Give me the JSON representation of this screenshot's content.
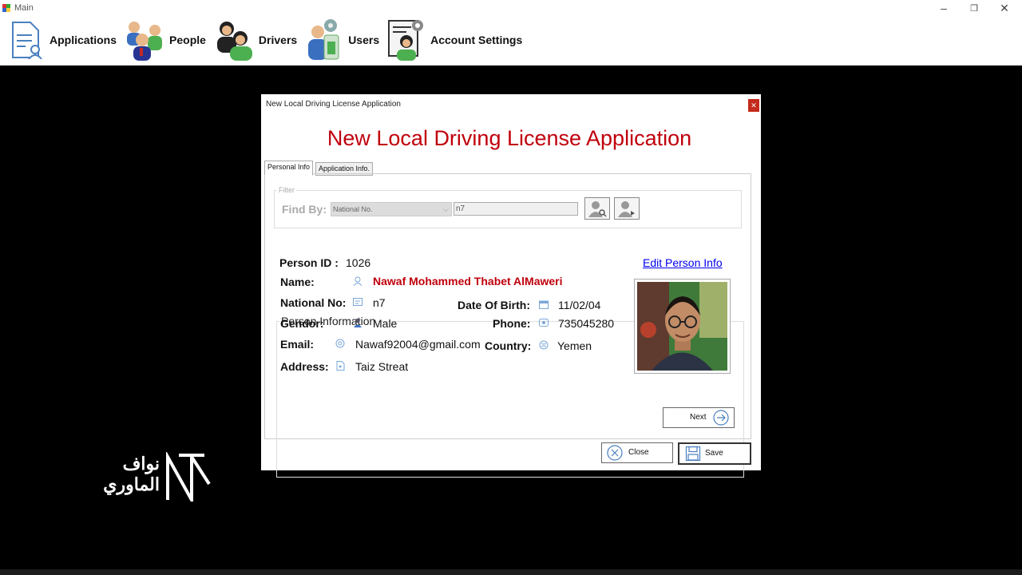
{
  "window": {
    "title": "Main"
  },
  "menu": [
    {
      "label": "Applications",
      "icon": "applications-icon"
    },
    {
      "label": "People",
      "icon": "people-icon"
    },
    {
      "label": "Drivers",
      "icon": "drivers-icon"
    },
    {
      "label": "Users",
      "icon": "users-icon"
    },
    {
      "label": "Account Settings",
      "icon": "account-settings-icon"
    }
  ],
  "dialog": {
    "title": "New Local Driving License Application",
    "heading": "New Local Driving License Application",
    "tabs": [
      "Personal Info",
      "Application Info."
    ],
    "filter": {
      "legend": "Filter",
      "find_by_label": "Find By:",
      "find_by_value": "National No.",
      "search_value": "n7"
    },
    "person": {
      "legend": "Person Information",
      "person_id_label": "Person ID :",
      "person_id": "1026",
      "edit_link": "Edit Person Info",
      "name_label": "Name:",
      "name": "Nawaf Mohammed Thabet AlMaweri",
      "national_no_label": "National No:",
      "national_no": "n7",
      "dob_label": "Date Of Birth:",
      "dob": "11/02/04",
      "gender_label": "Gendor:",
      "gender": "Male",
      "phone_label": "Phone:",
      "phone": "735045280",
      "email_label": "Email:",
      "email": "Nawaf92004@gmail.com",
      "country_label": "Country:",
      "country": "Yemen",
      "address_label": "Address:",
      "address": "Taiz Streat"
    },
    "buttons": {
      "next": "Next",
      "close": "Close",
      "save": "Save"
    }
  },
  "watermark": {
    "line1": "نواف",
    "line2": "الماوري"
  },
  "colors": {
    "heading": "#c0000c",
    "link": "#0000ee",
    "name": "#c0000c"
  }
}
